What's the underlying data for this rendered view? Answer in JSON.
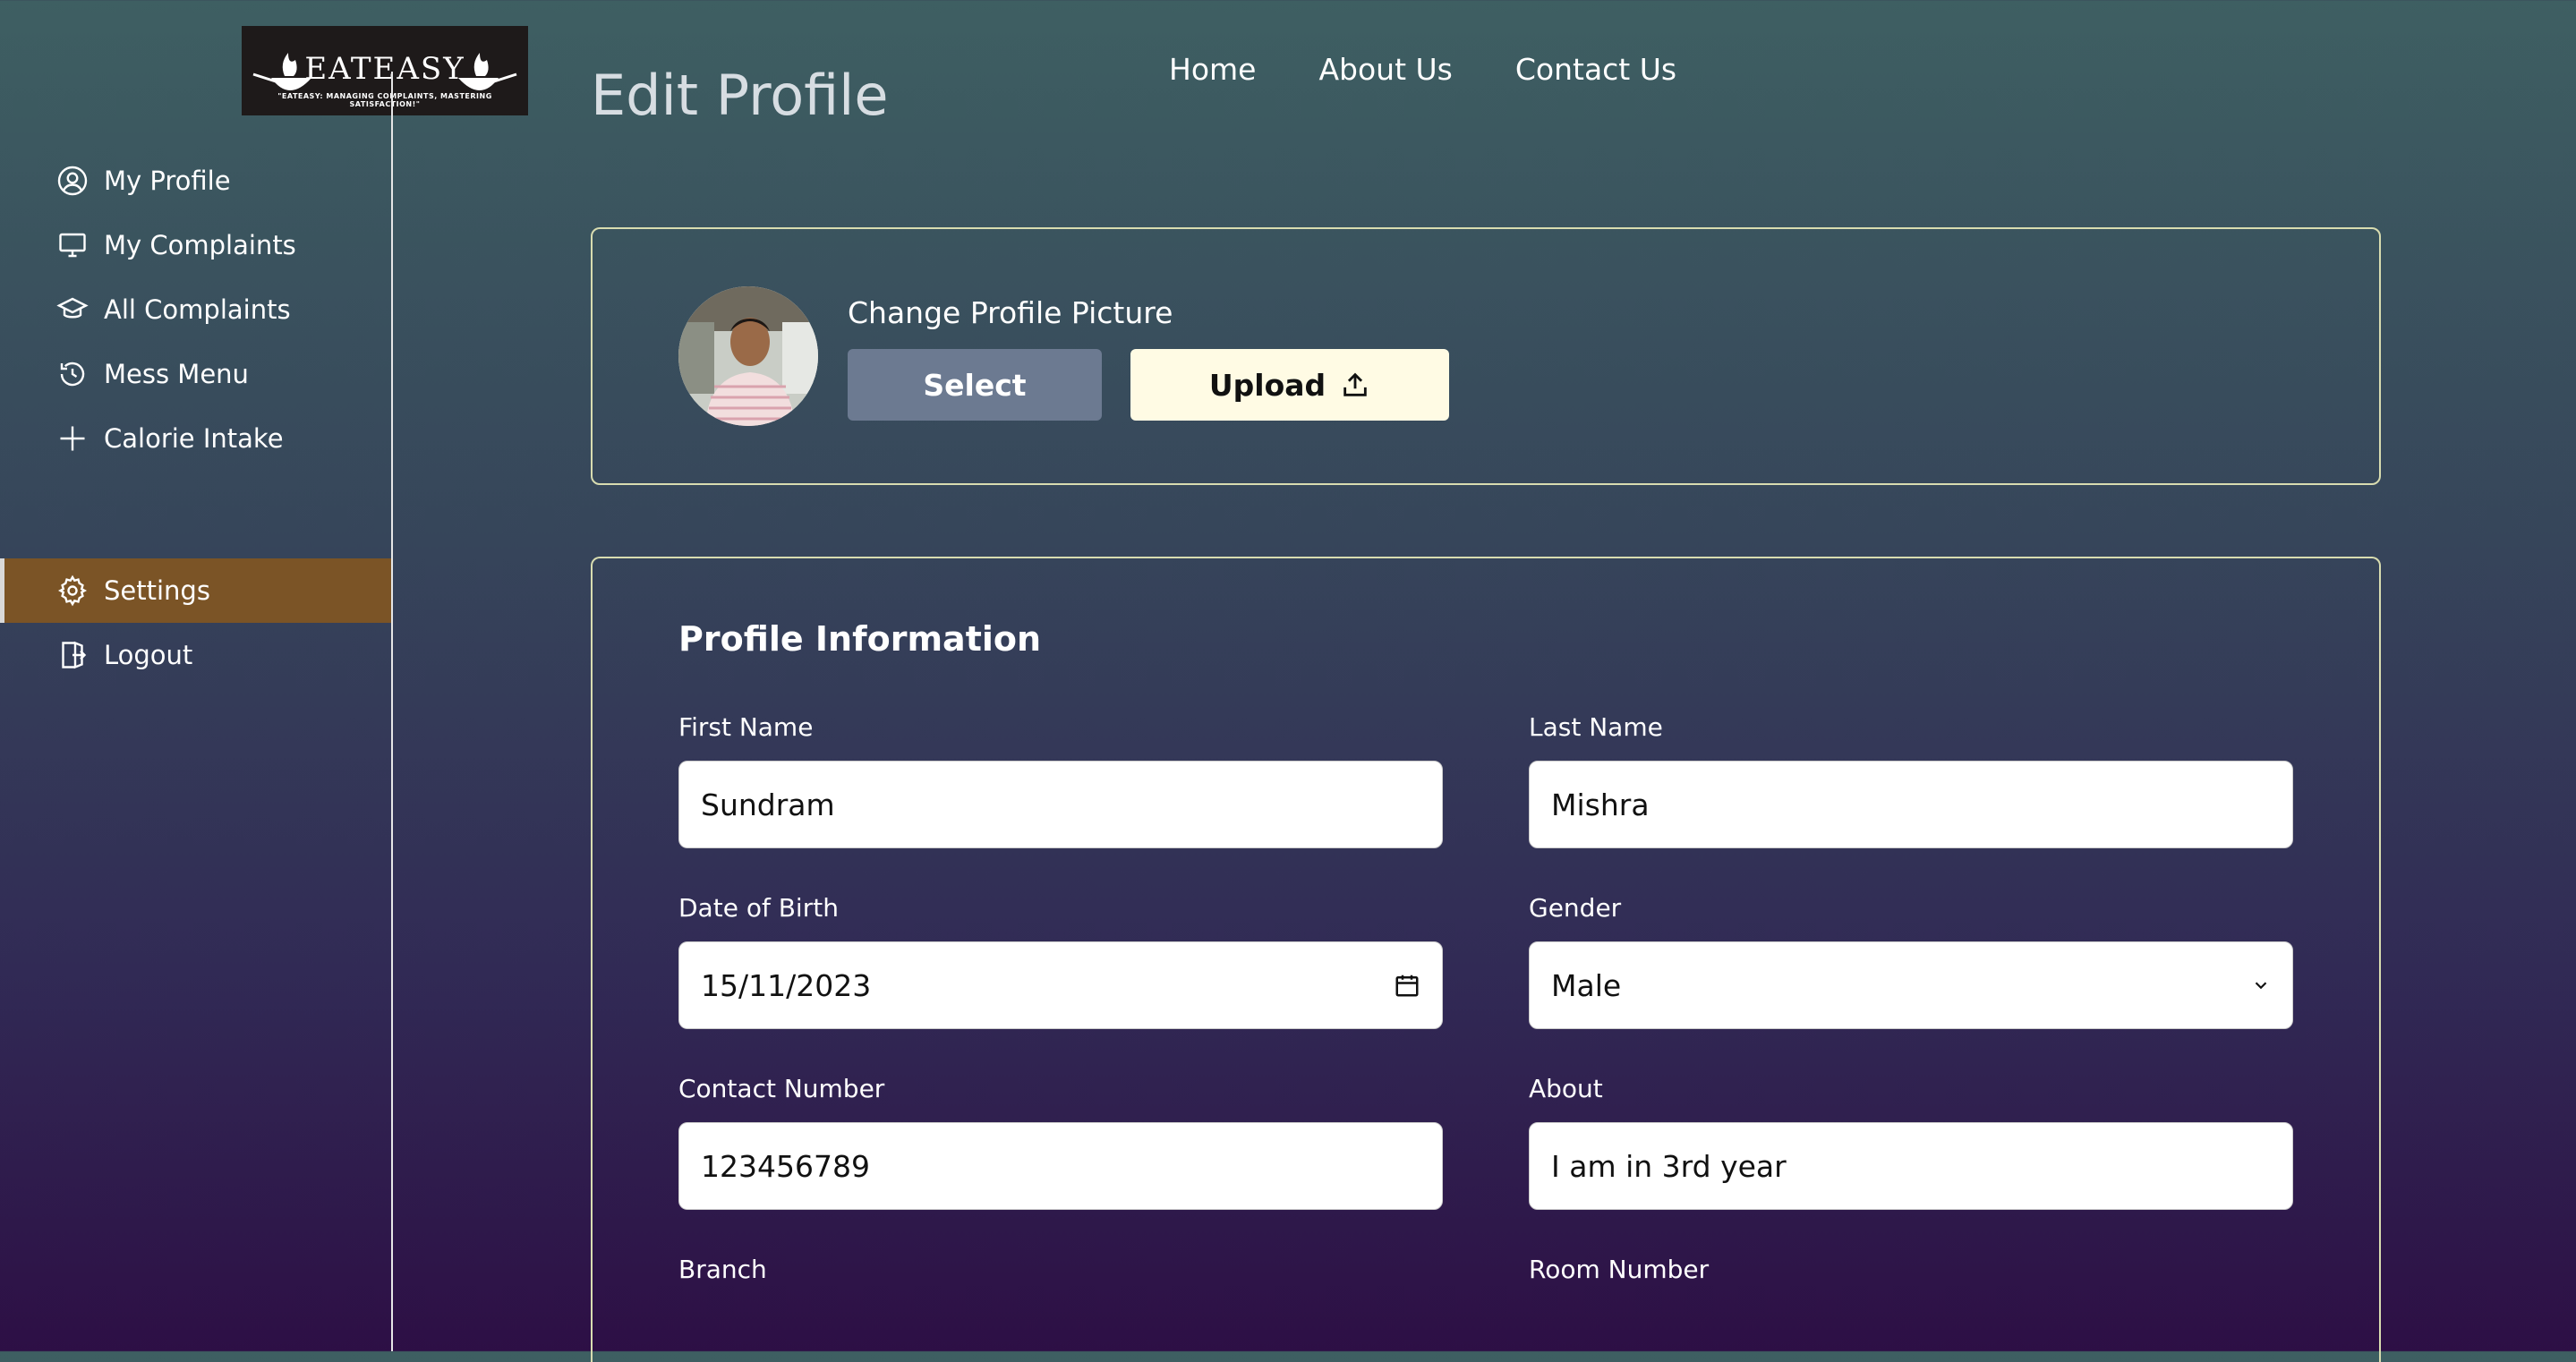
{
  "logo": {
    "brand": "EATEASY",
    "tagline": "\"EATEASY: MANAGING COMPLAINTS, MASTERING SATISFACTION!\""
  },
  "sidebar": {
    "items": [
      {
        "label": "My Profile",
        "icon": "user-circle-icon"
      },
      {
        "label": "My Complaints",
        "icon": "monitor-icon"
      },
      {
        "label": "All Complaints",
        "icon": "graduation-cap-icon"
      },
      {
        "label": "Mess Menu",
        "icon": "history-icon"
      },
      {
        "label": "Calorie Intake",
        "icon": "plus-icon"
      },
      {
        "label": "Settings",
        "icon": "gear-icon",
        "active": true
      },
      {
        "label": "Logout",
        "icon": "logout-icon"
      }
    ],
    "active_color": "#7b5426"
  },
  "header": {
    "title": "Edit Profile",
    "nav": [
      "Home",
      "About Us",
      "Contact Us"
    ]
  },
  "profile_picture": {
    "label": "Change Profile Picture",
    "select_label": "Select",
    "upload_label": "Upload"
  },
  "profile_info": {
    "title": "Profile Information",
    "fields": {
      "first_name": {
        "label": "First Name",
        "value": "Sundram"
      },
      "last_name": {
        "label": "Last Name",
        "value": "Mishra"
      },
      "dob": {
        "label": "Date of Birth",
        "value": "15/11/2023"
      },
      "gender": {
        "label": "Gender",
        "value": "Male"
      },
      "contact": {
        "label": "Contact Number",
        "value": "123456789"
      },
      "about": {
        "label": "About",
        "value": "I am in 3rd year"
      },
      "branch": {
        "label": "Branch"
      },
      "room": {
        "label": "Room Number"
      }
    }
  }
}
